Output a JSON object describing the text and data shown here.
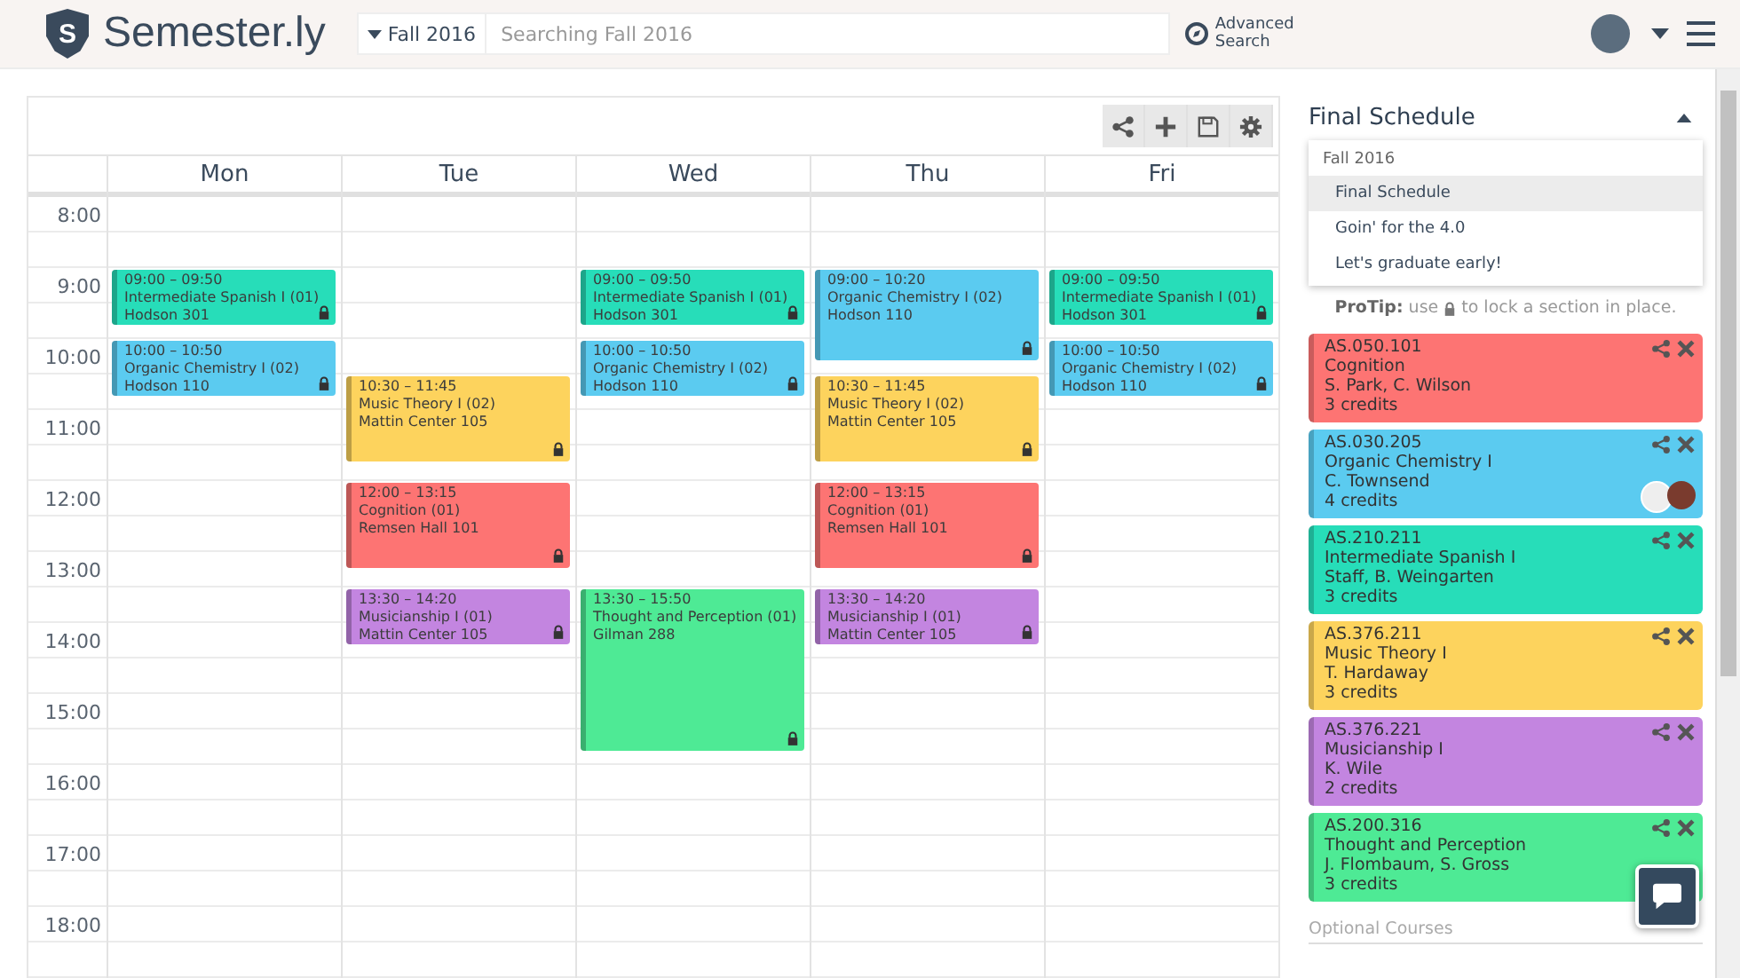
{
  "header": {
    "logo_mark": "S",
    "brand": "Semester.ly",
    "semester": "Fall 2016",
    "search": {
      "placeholder": "Searching Fall 2016"
    },
    "advanced_search": [
      "Advanced",
      "Search"
    ]
  },
  "calendar": {
    "hours": [
      "8:00",
      "9:00",
      "10:00",
      "11:00",
      "12:00",
      "13:00",
      "14:00",
      "15:00",
      "16:00",
      "17:00",
      "18:00"
    ],
    "days": [
      {
        "name": "Mon",
        "events": [
          {
            "time": "09:00 – 09:50",
            "title": "Intermediate Spanish I (01)",
            "location": "Hodson 301",
            "color": "#27ddb9",
            "locked": true
          },
          {
            "time": "10:00 – 10:50",
            "title": "Organic Chemistry I (02)",
            "location": "Hodson 110",
            "color": "#5bcbf0",
            "locked": true
          }
        ]
      },
      {
        "name": "Tue",
        "events": [
          {
            "time": "10:30 – 11:45",
            "title": "Music Theory I (02)",
            "location": "Mattin Center 105",
            "color": "#fdd35d",
            "locked": true
          },
          {
            "time": "12:00 – 13:15",
            "title": "Cognition (01)",
            "location": "Remsen Hall 101",
            "color": "#fd7473",
            "locked": true
          },
          {
            "time": "13:30 – 14:20",
            "title": "Musicianship I (01)",
            "location": "Mattin Center 105",
            "color": "#c385e0",
            "locked": true
          }
        ]
      },
      {
        "name": "Wed",
        "events": [
          {
            "time": "09:00 – 09:50",
            "title": "Intermediate Spanish I (01)",
            "location": "Hodson 301",
            "color": "#27ddb9",
            "locked": true
          },
          {
            "time": "10:00 – 10:50",
            "title": "Organic Chemistry I (02)",
            "location": "Hodson 110",
            "color": "#5bcbf0",
            "locked": true
          },
          {
            "time": "13:30 – 15:50",
            "title": "Thought and Perception (01)",
            "location": "Gilman 288",
            "color": "#4eea95",
            "locked": true
          }
        ]
      },
      {
        "name": "Thu",
        "events": [
          {
            "time": "09:00 – 10:20",
            "title": "Organic Chemistry I (02)",
            "location": "Hodson 110",
            "color": "#5bcbf0",
            "locked": true
          },
          {
            "time": "10:30 – 11:45",
            "title": "Music Theory I (02)",
            "location": "Mattin Center 105",
            "color": "#fdd35d",
            "locked": true
          },
          {
            "time": "12:00 – 13:15",
            "title": "Cognition (01)",
            "location": "Remsen Hall 101",
            "color": "#fd7473",
            "locked": true
          },
          {
            "time": "13:30 – 14:20",
            "title": "Musicianship I (01)",
            "location": "Mattin Center 105",
            "color": "#c385e0",
            "locked": true
          }
        ]
      },
      {
        "name": "Fri",
        "events": [
          {
            "time": "09:00 – 09:50",
            "title": "Intermediate Spanish I (01)",
            "location": "Hodson 301",
            "color": "#27ddb9",
            "locked": true
          },
          {
            "time": "10:00 – 10:50",
            "title": "Organic Chemistry I (02)",
            "location": "Hodson 110",
            "color": "#5bcbf0",
            "locked": true
          }
        ]
      }
    ]
  },
  "sidebar": {
    "schedule_title": "Final Schedule",
    "dropdown": {
      "expanded": true,
      "group": "Fall 2016",
      "items": [
        {
          "label": "Final Schedule",
          "selected": true
        },
        {
          "label": "Goin' for the 4.0",
          "selected": false
        },
        {
          "label": "Let's graduate early!",
          "selected": false
        }
      ]
    },
    "protip": {
      "before": "**ProTip:** use",
      "after": "to lock a section in place."
    },
    "courses": [
      {
        "code": "AS.050.101",
        "name": "Cognition",
        "instructors": "S. Park, C. Wilson",
        "credits": "3 credits",
        "color": "#fd7473",
        "friends": false
      },
      {
        "code": "AS.030.205",
        "name": "Organic Chemistry I",
        "instructors": "C. Townsend",
        "credits": "4 credits",
        "color": "#5bcbf0",
        "friends": true
      },
      {
        "code": "AS.210.211",
        "name": "Intermediate Spanish I",
        "instructors": "Staff, B. Weingarten",
        "credits": "3 credits",
        "color": "#27ddb9",
        "friends": false
      },
      {
        "code": "AS.376.211",
        "name": "Music Theory I",
        "instructors": "T. Hardaway",
        "credits": "3 credits",
        "color": "#fdd35d",
        "friends": false
      },
      {
        "code": "AS.376.221",
        "name": "Musicianship I",
        "instructors": "K. Wile",
        "credits": "2 credits",
        "color": "#c385e0",
        "friends": false
      },
      {
        "code": "AS.200.316",
        "name": "Thought and Perception",
        "instructors": "J. Flombaum, S. Gross",
        "credits": "3 credits",
        "color": "#4eea95",
        "friends": false
      }
    ],
    "optional_heading": "Optional Courses"
  }
}
